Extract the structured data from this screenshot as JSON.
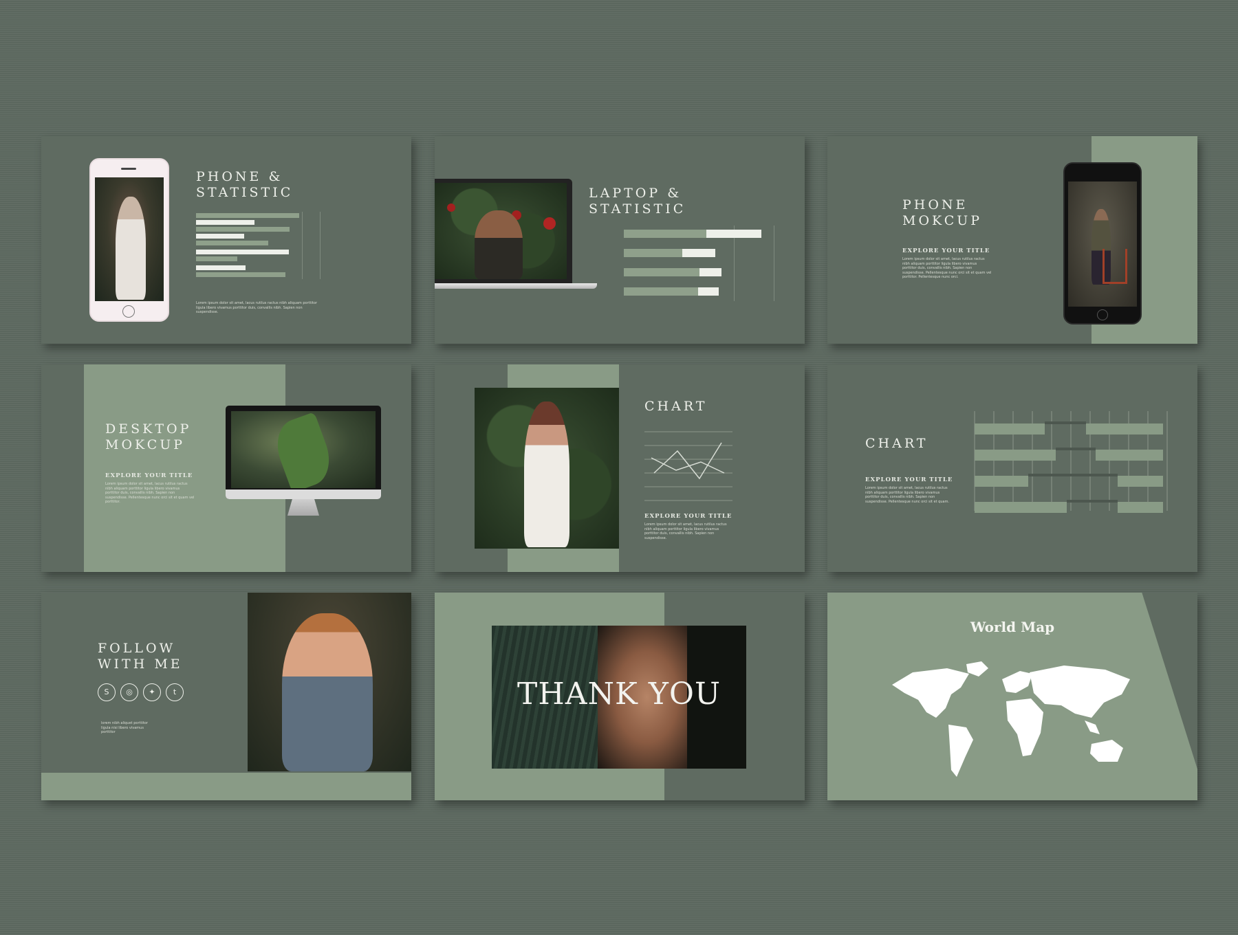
{
  "colors": {
    "background": "#5e6a61",
    "slide_dark": "#5f6b61",
    "slide_light": "#899b86",
    "accent_white": "#eef0ea"
  },
  "slides": {
    "phone_statistic": {
      "title": "PHONE &\nSTATISTIC",
      "body": "Lorem ipsum dolor sit amet, lacus rutilus ractus nibh aliquam porttitor ligula libero vivamus porttitor duis, convallis nibh. Sapien non suspendisse."
    },
    "laptop_statistic": {
      "title": "LAPTOP &\nSTATISTIC"
    },
    "phone_mockup": {
      "title": "PHONE\nMOKCUP",
      "subtitle": "EXPLORE YOUR TITLE",
      "body": "Lorem ipsum dolor sit amet, lacus rutilus ractus nibh aliquam porttitor ligula libero vivamus porttitor duis, convallis nibh. Sapien non suspendisse. Pellentesque nunc orci sit et quam vel porttitor. Pellentesque nunc orci."
    },
    "desktop_mockup": {
      "title": "DESKTOP\nMOKCUP",
      "subtitle": "EXPLORE YOUR TITLE",
      "body": "Lorem ipsum dolor sit amet, lacus rutilus ractus nibh aliquam porttitor ligula libero vivamus porttitor duis, convallis nibh. Sapien non suspendisse. Pellentesque nunc orci sit et quam vel porttitor."
    },
    "chart_line": {
      "title": "CHART",
      "subtitle": "EXPLORE YOUR TITLE",
      "body": "Lorem ipsum dolor sit amet, lacus rutilus ractus nibh aliquam porttitor ligula libero vivamus porttitor duis, convallis nibh. Sapien non suspendisse."
    },
    "chart_bars": {
      "title": "CHART",
      "subtitle": "EXPLORE YOUR TITLE",
      "body": "Lorem ipsum dolor sit amet, lacus rutilus ractus nibh aliquam porttitor ligula libero vivamus porttitor duis, convallis nibh. Sapien non suspendisse. Pellentesque nunc orci sit et quam."
    },
    "follow": {
      "title": "FOLLOW\nWITH ME",
      "icons": [
        "skype-icon",
        "instagram-icon",
        "twitter-icon",
        "tumblr-icon"
      ],
      "icon_glyphs": [
        "S",
        "◎",
        "✦",
        "t"
      ],
      "body": "lorem nibh aliquet porttitor ligula nisi libero vivamus porttitor"
    },
    "thank_you": {
      "title": "THANK YOU"
    },
    "world_map": {
      "title": "World Map"
    }
  }
}
